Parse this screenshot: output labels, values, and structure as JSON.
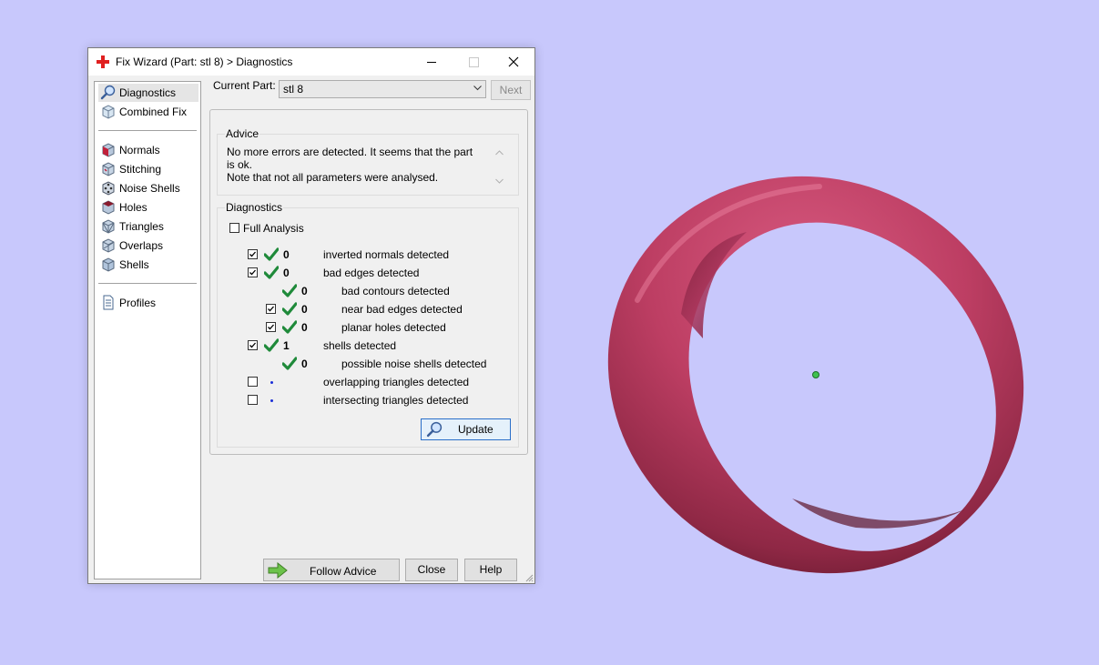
{
  "window": {
    "title": "Fix Wizard (Part: stl 8) > Diagnostics"
  },
  "nav": {
    "items": [
      {
        "label": "Diagnostics",
        "icon": "magnifier-icon",
        "selected": true
      },
      {
        "label": "Combined Fix",
        "icon": "cube-icon"
      },
      {
        "label": "Normals",
        "icon": "normals-cube-icon"
      },
      {
        "label": "Stitching",
        "icon": "stitching-cube-icon"
      },
      {
        "label": "Noise Shells",
        "icon": "noise-shells-cube-icon"
      },
      {
        "label": "Holes",
        "icon": "holes-cube-icon"
      },
      {
        "label": "Triangles",
        "icon": "triangles-cube-icon"
      },
      {
        "label": "Overlaps",
        "icon": "overlaps-cube-icon"
      },
      {
        "label": "Shells",
        "icon": "shells-cube-icon"
      },
      {
        "label": "Profiles",
        "icon": "document-icon"
      }
    ]
  },
  "header": {
    "current_part_label": "Current Part:",
    "current_part_value": "stl 8",
    "next_label": "Next"
  },
  "advice": {
    "title": "Advice",
    "line1": "No more errors are detected. It seems that the part is ok.",
    "line2": "Note that not all parameters were analysed."
  },
  "diagnostics": {
    "title": "Diagnostics",
    "full_analysis_label": "Full Analysis",
    "rows": [
      {
        "checked": true,
        "status": "ok",
        "count": "0",
        "text": "inverted normals detected"
      },
      {
        "checked": true,
        "status": "ok",
        "count": "0",
        "text": "bad edges detected"
      },
      {
        "checkbox": false,
        "status": "ok",
        "count": "0",
        "text": "bad contours detected"
      },
      {
        "checked": true,
        "status": "ok",
        "count": "0",
        "text": "near bad edges detected"
      },
      {
        "checked": true,
        "status": "ok",
        "count": "0",
        "text": "planar holes detected"
      },
      {
        "checked": true,
        "status": "ok",
        "count": "1",
        "text": "shells detected"
      },
      {
        "checkbox": false,
        "status": "ok",
        "count": "0",
        "text": "possible noise shells detected"
      },
      {
        "checked": false,
        "status": "unchecked",
        "text": "overlapping triangles detected"
      },
      {
        "checked": false,
        "status": "unchecked",
        "text": "intersecting triangles detected"
      }
    ],
    "update_label": "Update"
  },
  "footer": {
    "follow_advice_label": "Follow Advice",
    "close_label": "Close",
    "help_label": "Help"
  },
  "colors": {
    "viewport_background": "#c8c8fc",
    "ring": "#c2456a",
    "check_green": "#1f8a3a",
    "dot_blue": "#1a2ed8"
  }
}
